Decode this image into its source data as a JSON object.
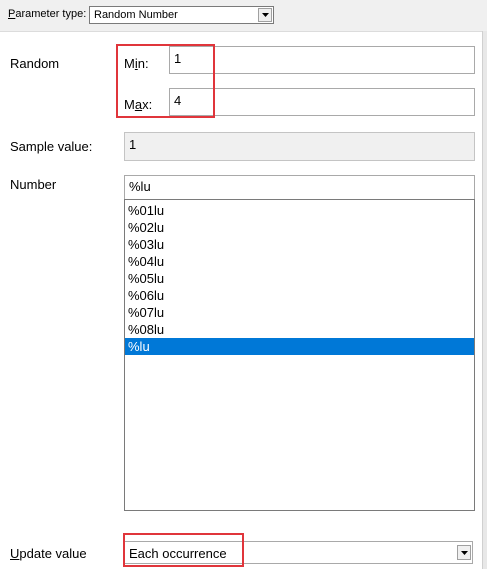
{
  "param_type": {
    "label_prefix": "P",
    "label_rest": "arameter type:",
    "value": "Random Number"
  },
  "random": {
    "section_label": "Random",
    "min": {
      "label_pre": "M",
      "label_u": "i",
      "label_post": "n:",
      "value": "1"
    },
    "max": {
      "label_pre": "M",
      "label_u": "a",
      "label_post": "x:",
      "value": "4"
    }
  },
  "sample": {
    "label": "Sample value:",
    "value": "1"
  },
  "number": {
    "label": "Number",
    "format_value": "%lu",
    "options": [
      "%01lu",
      "%02lu",
      "%03lu",
      "%04lu",
      "%05lu",
      "%06lu",
      "%07lu",
      "%08lu",
      "%lu"
    ],
    "selected_index": 8
  },
  "update": {
    "label_u": "U",
    "label_rest": "pdate value",
    "value": "Each occurrence"
  },
  "colors": {
    "selection": "#0078d7",
    "highlight": "#e0353b"
  }
}
